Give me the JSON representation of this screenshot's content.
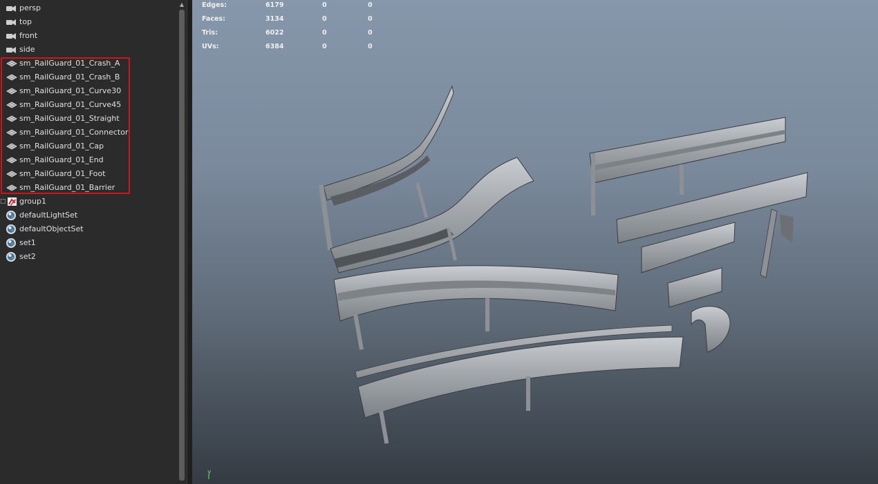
{
  "outliner": {
    "items": [
      {
        "label": "persp",
        "icon": "camera-icon"
      },
      {
        "label": "top",
        "icon": "camera-icon"
      },
      {
        "label": "front",
        "icon": "camera-icon"
      },
      {
        "label": "side",
        "icon": "camera-icon"
      },
      {
        "label": "sm_RailGuard_01_Crash_A",
        "icon": "mesh-icon"
      },
      {
        "label": "sm_RailGuard_01_Crash_B",
        "icon": "mesh-icon"
      },
      {
        "label": "sm_RailGuard_01_Curve30",
        "icon": "mesh-icon"
      },
      {
        "label": "sm_RailGuard_01_Curve45",
        "icon": "mesh-icon"
      },
      {
        "label": "sm_RailGuard_01_Straight",
        "icon": "mesh-icon"
      },
      {
        "label": "sm_RailGuard_01_Connector",
        "icon": "mesh-icon"
      },
      {
        "label": "sm_RailGuard_01_Cap",
        "icon": "mesh-icon"
      },
      {
        "label": "sm_RailGuard_01_End",
        "icon": "mesh-icon"
      },
      {
        "label": "sm_RailGuard_01_Foot",
        "icon": "mesh-icon"
      },
      {
        "label": "sm_RailGuard_01_Barrier",
        "icon": "mesh-icon"
      },
      {
        "label": "group1",
        "icon": "group-icon"
      },
      {
        "label": "defaultLightSet",
        "icon": "set-icon"
      },
      {
        "label": "defaultObjectSet",
        "icon": "set-icon"
      },
      {
        "label": "set1",
        "icon": "set-icon"
      },
      {
        "label": "set2",
        "icon": "set-icon"
      }
    ],
    "highlight_color": "#d1141b"
  },
  "hud": {
    "rows": [
      {
        "label": "Edges:",
        "v1": "6179",
        "v2": "0",
        "v3": "0"
      },
      {
        "label": "Faces:",
        "v1": "3134",
        "v2": "0",
        "v3": "0"
      },
      {
        "label": "Tris:",
        "v1": "6022",
        "v2": "0",
        "v3": "0"
      },
      {
        "label": "UVs:",
        "v1": "6384",
        "v2": "0",
        "v3": "0"
      }
    ]
  },
  "viewport": {
    "axis_label": "y"
  }
}
